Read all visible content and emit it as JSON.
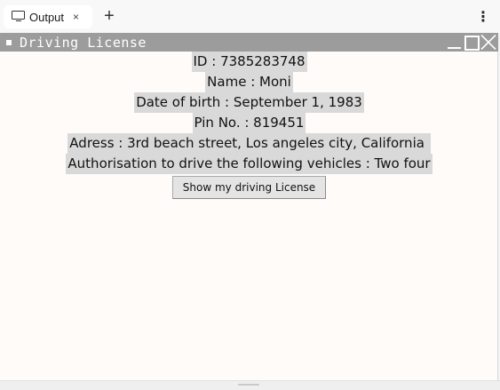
{
  "tab": {
    "label": "Output",
    "icon": "monitor-icon",
    "close": "×"
  },
  "toolbar": {
    "add": "+",
    "more": "⋮"
  },
  "window": {
    "title": "Driving License",
    "fields": [
      "ID : 7385283748",
      "Name : Moni",
      "Date of birth : September 1, 1983",
      "Pin No. : 819451",
      "Adress : 3rd beach street, Los angeles city, California ",
      "Authorisation to drive the following vehicles : Two four"
    ],
    "button_label": "Show my driving License"
  }
}
